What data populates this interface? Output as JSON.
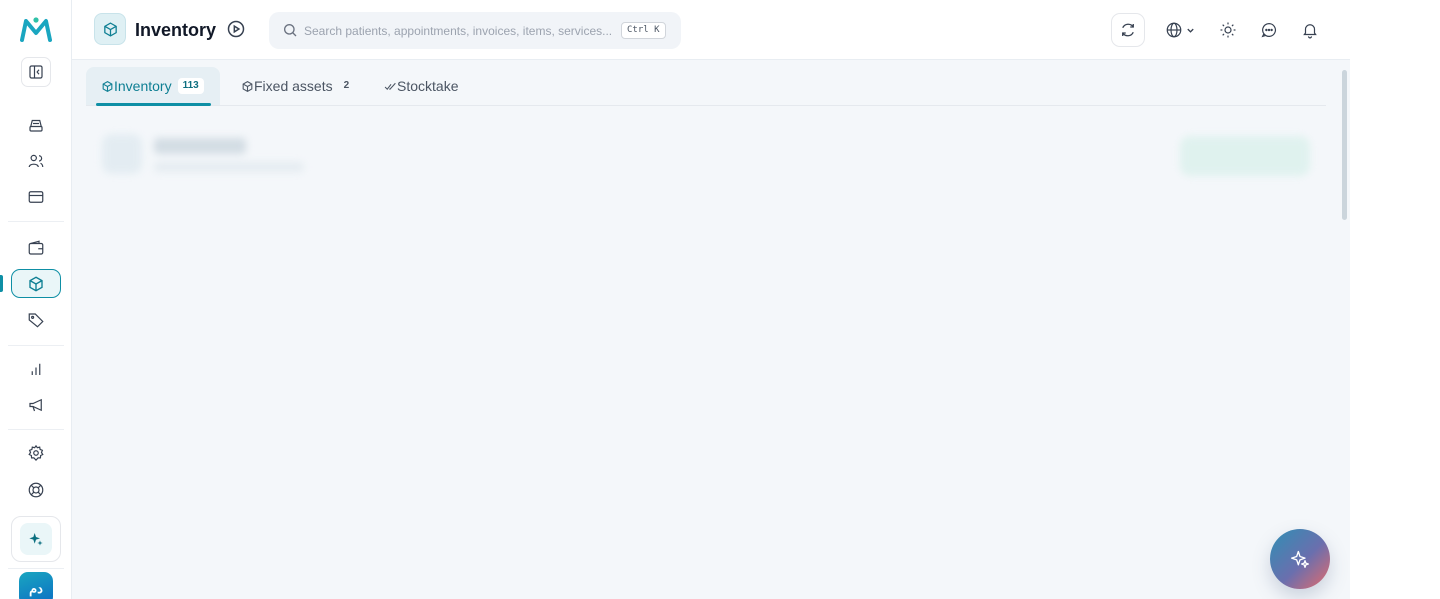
{
  "brand": {
    "logo_icon": "m-logo-icon",
    "accent": "#0e8fa5"
  },
  "sidebar": {
    "collapse_icon": "sidebar-collapse-icon",
    "items": [
      {
        "name": "inbox",
        "icon": "inbox-icon"
      },
      {
        "name": "patients",
        "icon": "users-icon"
      },
      {
        "name": "billing",
        "icon": "credit-card-icon"
      },
      {
        "name": "wallet",
        "icon": "wallet-icon"
      },
      {
        "name": "inventory",
        "icon": "box-icon",
        "active": true
      },
      {
        "name": "pricing",
        "icon": "tag-icon"
      },
      {
        "name": "reports",
        "icon": "bar-chart-icon"
      },
      {
        "name": "marketing",
        "icon": "megaphone-icon"
      },
      {
        "name": "settings",
        "icon": "gear-icon"
      },
      {
        "name": "support",
        "icon": "lifebuoy-icon"
      }
    ],
    "ai_icon": "sparkle-icon",
    "avatar_initials": "دم"
  },
  "header": {
    "title": "Inventory",
    "search": {
      "placeholder": "Search patients, appointments, invoices, items, services...",
      "shortcut": "Ctrl K"
    }
  },
  "tabs": [
    {
      "label": "Inventory",
      "count": "113",
      "active": true
    },
    {
      "label": "Fixed assets",
      "count": "2",
      "active": false
    },
    {
      "label": "Stocktake",
      "active": false
    }
  ]
}
